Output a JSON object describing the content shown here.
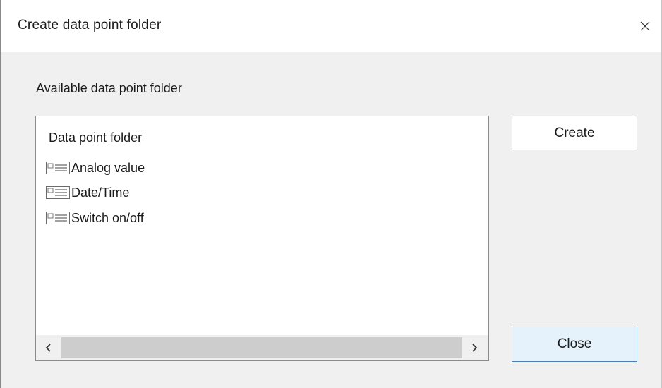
{
  "window": {
    "title": "Create data point folder",
    "close_icon": "close-icon"
  },
  "main": {
    "section_label": "Available data point folder",
    "list": {
      "header": "Data point folder",
      "items": [
        {
          "label": "Analog value",
          "icon": "folder-card-icon"
        },
        {
          "label": "Date/Time",
          "icon": "folder-card-icon"
        },
        {
          "label": "Switch on/off",
          "icon": "folder-card-icon"
        }
      ]
    },
    "scrollbar": {
      "left_icon": "scroll-left-icon",
      "right_icon": "scroll-right-icon"
    }
  },
  "buttons": {
    "create_label": "Create",
    "close_label": "Close"
  },
  "colors": {
    "dialog_background": "#f0f0f0",
    "titlebar_background": "#ffffff",
    "default_button_background": "#e5f1fb",
    "default_button_border": "#4d7fb5",
    "scroll_thumb": "#cdcdcd"
  }
}
